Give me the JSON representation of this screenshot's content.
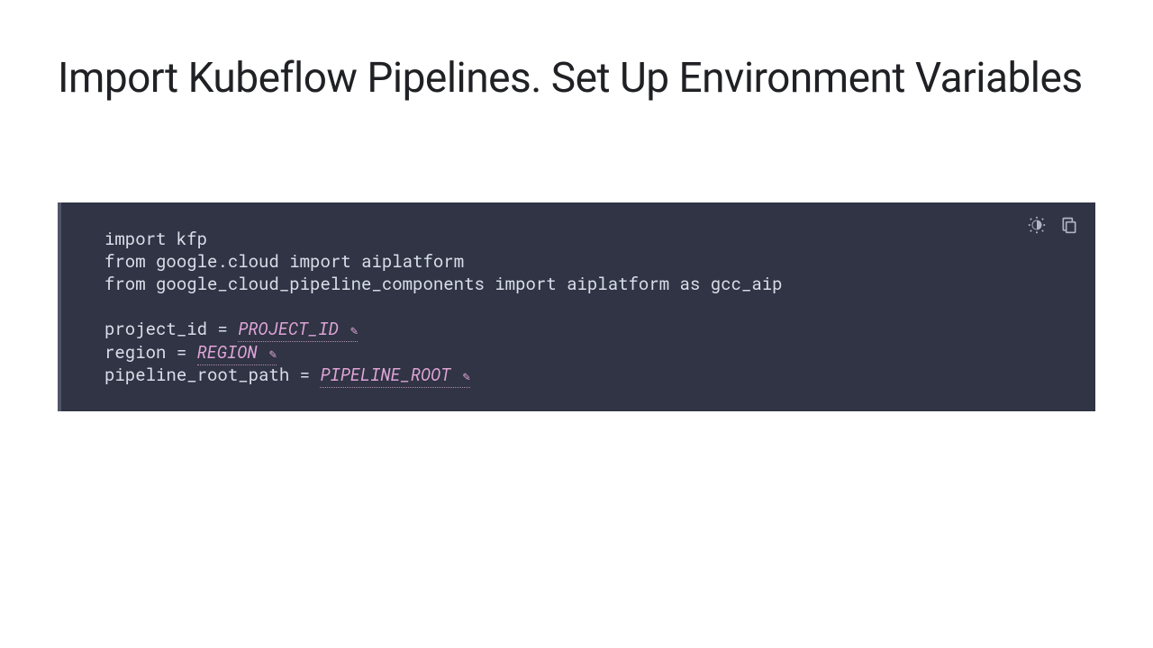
{
  "slide": {
    "title": "Import Kubeflow Pipelines. Set Up Environment Variables"
  },
  "code": {
    "line1_import": "import",
    "line1_rest": " kfp",
    "line2_from": "from",
    "line2_mid": " google.cloud ",
    "line2_import": "import",
    "line2_rest": " aiplatform",
    "line3_from": "from",
    "line3_mid": " google_cloud_pipeline_components ",
    "line3_import": "import",
    "line3_mid2": " aiplatform ",
    "line3_as": "as",
    "line3_rest": " gcc_aip",
    "line5_left": "project_id = ",
    "line5_ph": "PROJECT_ID",
    "line6_left": "region = ",
    "line6_ph": "REGION",
    "line7_left": "pipeline_root_path = ",
    "line7_ph": "PIPELINE_ROOT"
  },
  "icons": {
    "theme": "theme-icon",
    "copy": "copy-icon"
  }
}
